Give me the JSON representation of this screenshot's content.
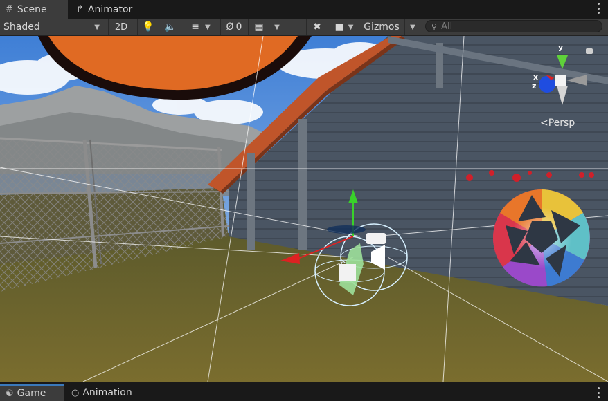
{
  "top_tabs": [
    {
      "label": "Scene",
      "icon": "grid-icon",
      "active": true
    },
    {
      "label": "Animator",
      "icon": "animator-icon",
      "active": false
    }
  ],
  "toolbar": {
    "shading_mode": "Shaded",
    "toggle_2d": "2D",
    "hidden_count": "0",
    "gizmos": "Gizmos",
    "search_placeholder": "All"
  },
  "scene_gizmo": {
    "axis_y": "y",
    "axis_x": "x",
    "axis_z": "z",
    "projection": "Persp"
  },
  "bottom_tabs": [
    {
      "label": "Game",
      "icon": "gamepad-icon",
      "active": true
    },
    {
      "label": "Animation",
      "icon": "clock-icon",
      "active": false
    }
  ],
  "colors": {
    "panel_bg": "#3c3c3c",
    "tab_bg": "#191919",
    "accent": "#3a79bb",
    "sky": "#4d8ad8",
    "grass": "#6b6128",
    "wall": "#4d5a66",
    "roof": "#c0552a"
  }
}
